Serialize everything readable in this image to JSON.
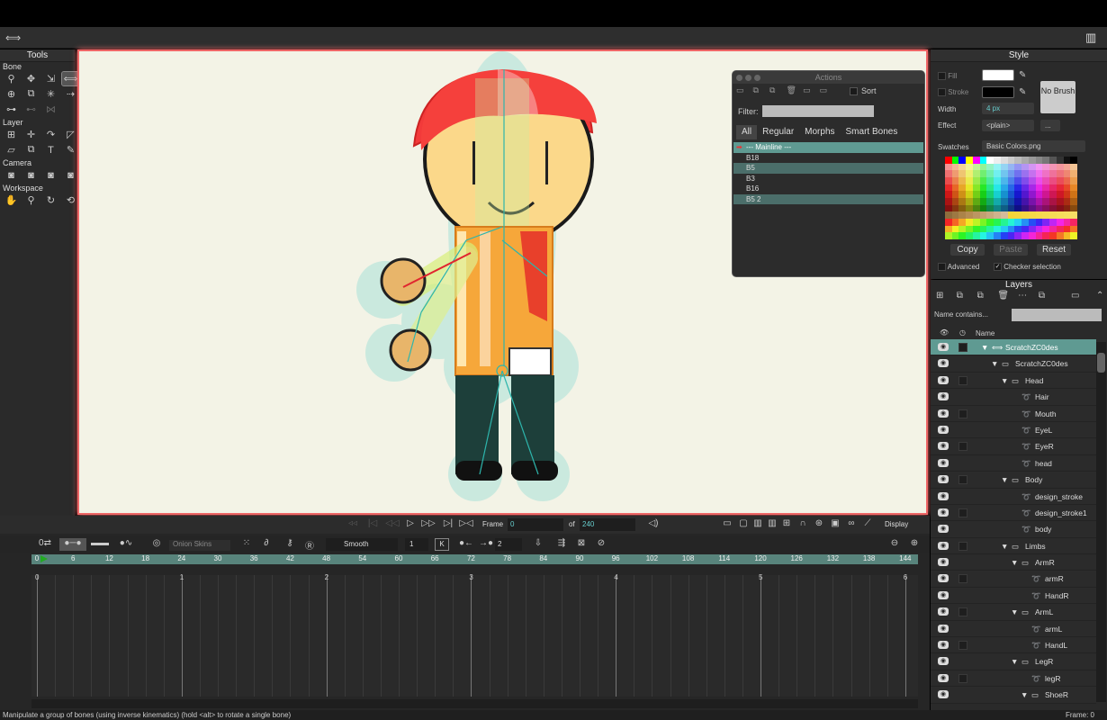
{
  "toolbar": {
    "left_icon": "bone-icon",
    "right_icon": "book-icon"
  },
  "tools": {
    "title": "Tools",
    "sections": [
      {
        "label": "Bone",
        "rows": 3
      },
      {
        "label": "Layer",
        "rows": 2
      },
      {
        "label": "Camera",
        "rows": 1
      },
      {
        "label": "Workspace",
        "rows": 1
      }
    ]
  },
  "actions": {
    "title": "Actions",
    "sort": "Sort",
    "filter": "Filter:",
    "tabs": [
      "All",
      "Regular",
      "Morphs",
      "Smart Bones"
    ],
    "items": [
      {
        "label": "--- Mainline ---",
        "state": "main"
      },
      {
        "label": "B18",
        "state": ""
      },
      {
        "label": "B5",
        "state": "sel"
      },
      {
        "label": "B3",
        "state": ""
      },
      {
        "label": "B16",
        "state": ""
      },
      {
        "label": "B5 2",
        "state": "sel"
      }
    ]
  },
  "style": {
    "title": "Style",
    "fill": "Fill",
    "stroke": "Stroke",
    "fill_color": "#ffffff",
    "stroke_color": "#000000",
    "width_label": "Width",
    "width_value": "4 px",
    "effect_label": "Effect",
    "effect_value": "<plain>",
    "effect_more": "...",
    "no_brush": "No Brush",
    "swatches_label": "Swatches",
    "swatches_value": "Basic Colors.png",
    "copy": "Copy",
    "paste": "Paste",
    "reset": "Reset",
    "advanced": "Advanced",
    "checker": "Checker selection"
  },
  "layers": {
    "title": "Layers",
    "filter_mode": "Name contains...",
    "name_header": "Name",
    "rows": [
      {
        "name": "ScratchZC0des",
        "depth": 0,
        "type": "bone",
        "expanded": true,
        "selected": true,
        "checkbox": true
      },
      {
        "name": "ScratchZC0des",
        "depth": 1,
        "type": "group",
        "expanded": true,
        "selected": false,
        "checkbox": false
      },
      {
        "name": "Head",
        "depth": 2,
        "type": "group",
        "expanded": true,
        "selected": false,
        "checkbox": true
      },
      {
        "name": "Hair",
        "depth": 3,
        "type": "vector",
        "selected": false,
        "checkbox": false
      },
      {
        "name": "Mouth",
        "depth": 3,
        "type": "vector",
        "selected": false,
        "checkbox": true
      },
      {
        "name": "EyeL",
        "depth": 3,
        "type": "vector",
        "selected": false,
        "checkbox": false
      },
      {
        "name": "EyeR",
        "depth": 3,
        "type": "vector",
        "selected": false,
        "checkbox": true
      },
      {
        "name": "head",
        "depth": 3,
        "type": "vector",
        "selected": false,
        "checkbox": false
      },
      {
        "name": "Body",
        "depth": 2,
        "type": "group",
        "expanded": true,
        "selected": false,
        "checkbox": true
      },
      {
        "name": "design_stroke",
        "depth": 3,
        "type": "vector",
        "selected": false,
        "checkbox": false
      },
      {
        "name": "design_stroke1",
        "depth": 3,
        "type": "vector",
        "selected": false,
        "checkbox": true
      },
      {
        "name": "body",
        "depth": 3,
        "type": "vector",
        "selected": false,
        "checkbox": false
      },
      {
        "name": "Limbs",
        "depth": 2,
        "type": "group",
        "expanded": true,
        "selected": false,
        "checkbox": true
      },
      {
        "name": "ArmR",
        "depth": 3,
        "type": "group",
        "expanded": true,
        "selected": false,
        "checkbox": false
      },
      {
        "name": "armR",
        "depth": 4,
        "type": "vector",
        "selected": false,
        "checkbox": true
      },
      {
        "name": "HandR",
        "depth": 4,
        "type": "vector",
        "selected": false,
        "checkbox": false
      },
      {
        "name": "ArmL",
        "depth": 3,
        "type": "group",
        "expanded": true,
        "selected": false,
        "checkbox": true
      },
      {
        "name": "armL",
        "depth": 4,
        "type": "vector",
        "selected": false,
        "checkbox": false
      },
      {
        "name": "HandL",
        "depth": 4,
        "type": "vector",
        "selected": false,
        "checkbox": true
      },
      {
        "name": "LegR",
        "depth": 3,
        "type": "group",
        "expanded": true,
        "selected": false,
        "checkbox": false
      },
      {
        "name": "legR",
        "depth": 4,
        "type": "vector",
        "selected": false,
        "checkbox": true
      },
      {
        "name": "ShoeR",
        "depth": 4,
        "type": "group",
        "expanded": true,
        "selected": false,
        "checkbox": false
      }
    ]
  },
  "transport": {
    "frame_label": "Frame",
    "frame_value": "0",
    "of_label": "of",
    "total_frames": "240",
    "display": "Display"
  },
  "timeline_tools": {
    "onion": "Onion Skins",
    "interp": "Smooth",
    "interval": "1",
    "key_k": "K",
    "step": "2"
  },
  "ruler": {
    "ticks": [
      "0",
      "6",
      "12",
      "18",
      "24",
      "30",
      "36",
      "42",
      "48",
      "54",
      "60",
      "66",
      "72",
      "78",
      "84",
      "90",
      "96",
      "102",
      "108",
      "114",
      "120",
      "126",
      "132",
      "138",
      "144"
    ]
  },
  "seconds": [
    "0",
    "1",
    "2",
    "3",
    "4",
    "5",
    "6"
  ],
  "status": {
    "message": "Manipulate a group of bones (using inverse kinematics) (hold <alt> to rotate a single bone)",
    "frame": "Frame: 0"
  }
}
